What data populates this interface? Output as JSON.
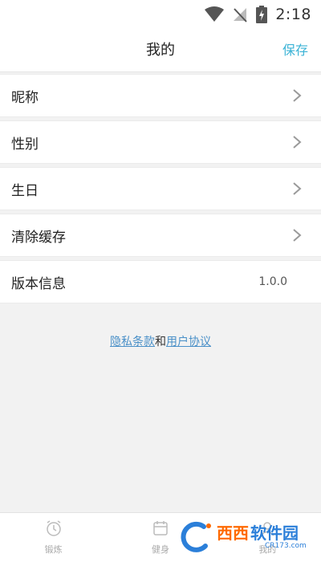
{
  "status_bar": {
    "time": "2:18"
  },
  "header": {
    "title": "我的",
    "save_label": "保存"
  },
  "menu": {
    "items": [
      {
        "label": "昵称"
      },
      {
        "label": "性别"
      },
      {
        "label": "生日"
      },
      {
        "label": "清除缓存"
      }
    ],
    "version": {
      "label": "版本信息",
      "value": "1.0.0"
    }
  },
  "links": {
    "privacy": "隐私条款",
    "and": "和",
    "agreement": "用户协议"
  },
  "bottom_nav": {
    "tabs": [
      {
        "label": "锻炼",
        "icon": "alarm-clock-icon"
      },
      {
        "label": "健身",
        "icon": "calendar-icon"
      },
      {
        "label": "我的",
        "icon": "profile-icon"
      }
    ]
  },
  "watermark": {
    "brand_a": "西西",
    "brand_b": "软件园",
    "url": "CR173.com"
  },
  "colors": {
    "accent": "#3bb3d6",
    "link": "#4a90c8",
    "background": "#f2f2f2"
  }
}
